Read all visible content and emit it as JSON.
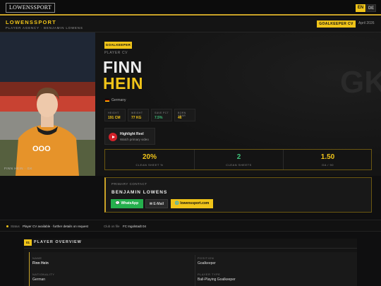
{
  "topbar": {
    "logo": "LOWENSSPORT",
    "lang_en": "EN",
    "lang_de": "DE"
  },
  "header": {
    "brand": "LOWENSSPORT",
    "subtitle": "PLAYER AGENCY · BENJAMIN LOWENS",
    "badge": "GOALKEEPER CV",
    "date": "April 2026"
  },
  "player": {
    "position_badge": "GOALKEEPER",
    "cv_label": "PLAYER CV",
    "first_name": "FINN",
    "last_name": "HEIN",
    "position_bg": "GK",
    "nationality": "Germany",
    "photo_caption": "FINN HEIN · GK",
    "stats": [
      {
        "label": "HEIGHT",
        "value": "191 CM"
      },
      {
        "label": "WEIGHT",
        "value": "77 KG"
      },
      {
        "label": "SAVE PCT",
        "value": "7.5%"
      },
      {
        "label": "BORN YEAR",
        "value": "46"
      }
    ],
    "highlight": {
      "title": "Highlight Reel",
      "subtitle": "Watch primary video"
    },
    "kpis": [
      {
        "value": "20%",
        "label": "CLEAN SHEET %",
        "color": "#f0c419"
      },
      {
        "value": "2",
        "label": "CLEAN SHEETS",
        "color": "#3ec17a"
      },
      {
        "value": "1.50",
        "label": "GA / 90",
        "color": "#f0c419"
      }
    ]
  },
  "contact": {
    "label": "PRIMARY CONTACT",
    "name": "BENJAMIN LOWENS",
    "whatsapp": "💬 WhatsApp",
    "email": "✉ E-Mail",
    "website": "🌐 lowenssport.com"
  },
  "status": {
    "label": "Status",
    "text": "Player CV available · further details on request",
    "club_label": "Club on file",
    "club": "FC Ingolstadt 04"
  },
  "overview": {
    "number": "01",
    "title": "PLAYER OVERVIEW",
    "fields": [
      {
        "label": "NAME",
        "value": "Finn Hein"
      },
      {
        "label": "POSITION",
        "value": "Goalkeeper"
      },
      {
        "label": "NATIONALITY",
        "value": "German"
      },
      {
        "label": "PLAYER TYPE",
        "value": "Ball-Playing Goalkeeper"
      }
    ]
  }
}
